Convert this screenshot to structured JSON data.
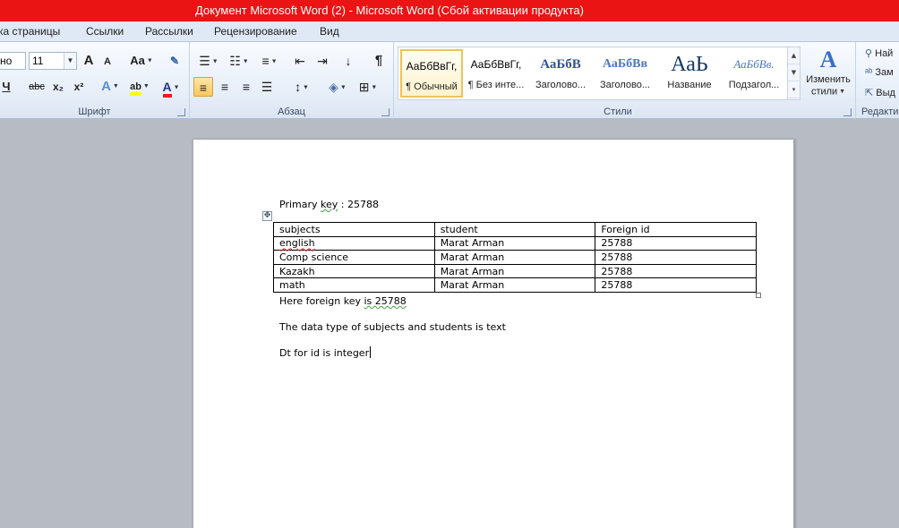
{
  "window": {
    "title": "Документ Microsoft Word (2)  -  Microsoft Word (Сбой активации продукта)"
  },
  "tabs": [
    "ка страницы",
    "Ссылки",
    "Рассылки",
    "Рецензирование",
    "Вид"
  ],
  "font_group": {
    "font_name": "но",
    "font_size": "11",
    "label": "Шрифт",
    "buttons": [
      "A",
      "A",
      "Aa",
      "Ч",
      "abc",
      "x₂",
      "x²",
      "A",
      "ab",
      "A"
    ]
  },
  "paragraph_group": {
    "label": "Абзац"
  },
  "styles_group": {
    "label": "Стили",
    "items": [
      {
        "preview": "АаБбВвГг,",
        "name": "¶ Обычный",
        "selected": true
      },
      {
        "preview": "АаБбВвГг,",
        "name": "¶ Без инте..."
      },
      {
        "preview": "АаБбВ",
        "name": "Заголово..."
      },
      {
        "preview": "АаБбВв",
        "name": "Заголово..."
      },
      {
        "preview": "АаЬ",
        "name": "Название"
      },
      {
        "preview": "АаБбВв.",
        "name": "Подзагол..."
      }
    ],
    "change_styles_line1": "Изменить",
    "change_styles_line2": "стили"
  },
  "editing_group": {
    "label": "Редакти",
    "items": [
      "Най",
      "Зам",
      "Выд"
    ]
  },
  "colors": {
    "titlebar": "#ea1414",
    "ribbon": "#e6eef8",
    "highlight": "#f9c85f",
    "font_color": "#e02020",
    "highlight_color": "#ffff00"
  },
  "document": {
    "primary_key_prefix": "Primary ",
    "primary_key_word": "key",
    "primary_key_suffix": " : 25788",
    "table": {
      "headers": [
        "subjects",
        "student",
        "Foreign id"
      ],
      "rows": [
        [
          "english",
          "Marat Arman",
          "25788"
        ],
        [
          "Comp science",
          "Marat Arman",
          "25788"
        ],
        [
          "Kazakh",
          "Marat Arman",
          "25788"
        ],
        [
          "math",
          "Marat Arman",
          "25788"
        ]
      ]
    },
    "foreign_key_prefix": "Here foreign key ",
    "foreign_key_rest": "is  25788",
    "line_datatype": "The data type of subjects and students is text",
    "line_dt": "Dt for id is integer"
  }
}
